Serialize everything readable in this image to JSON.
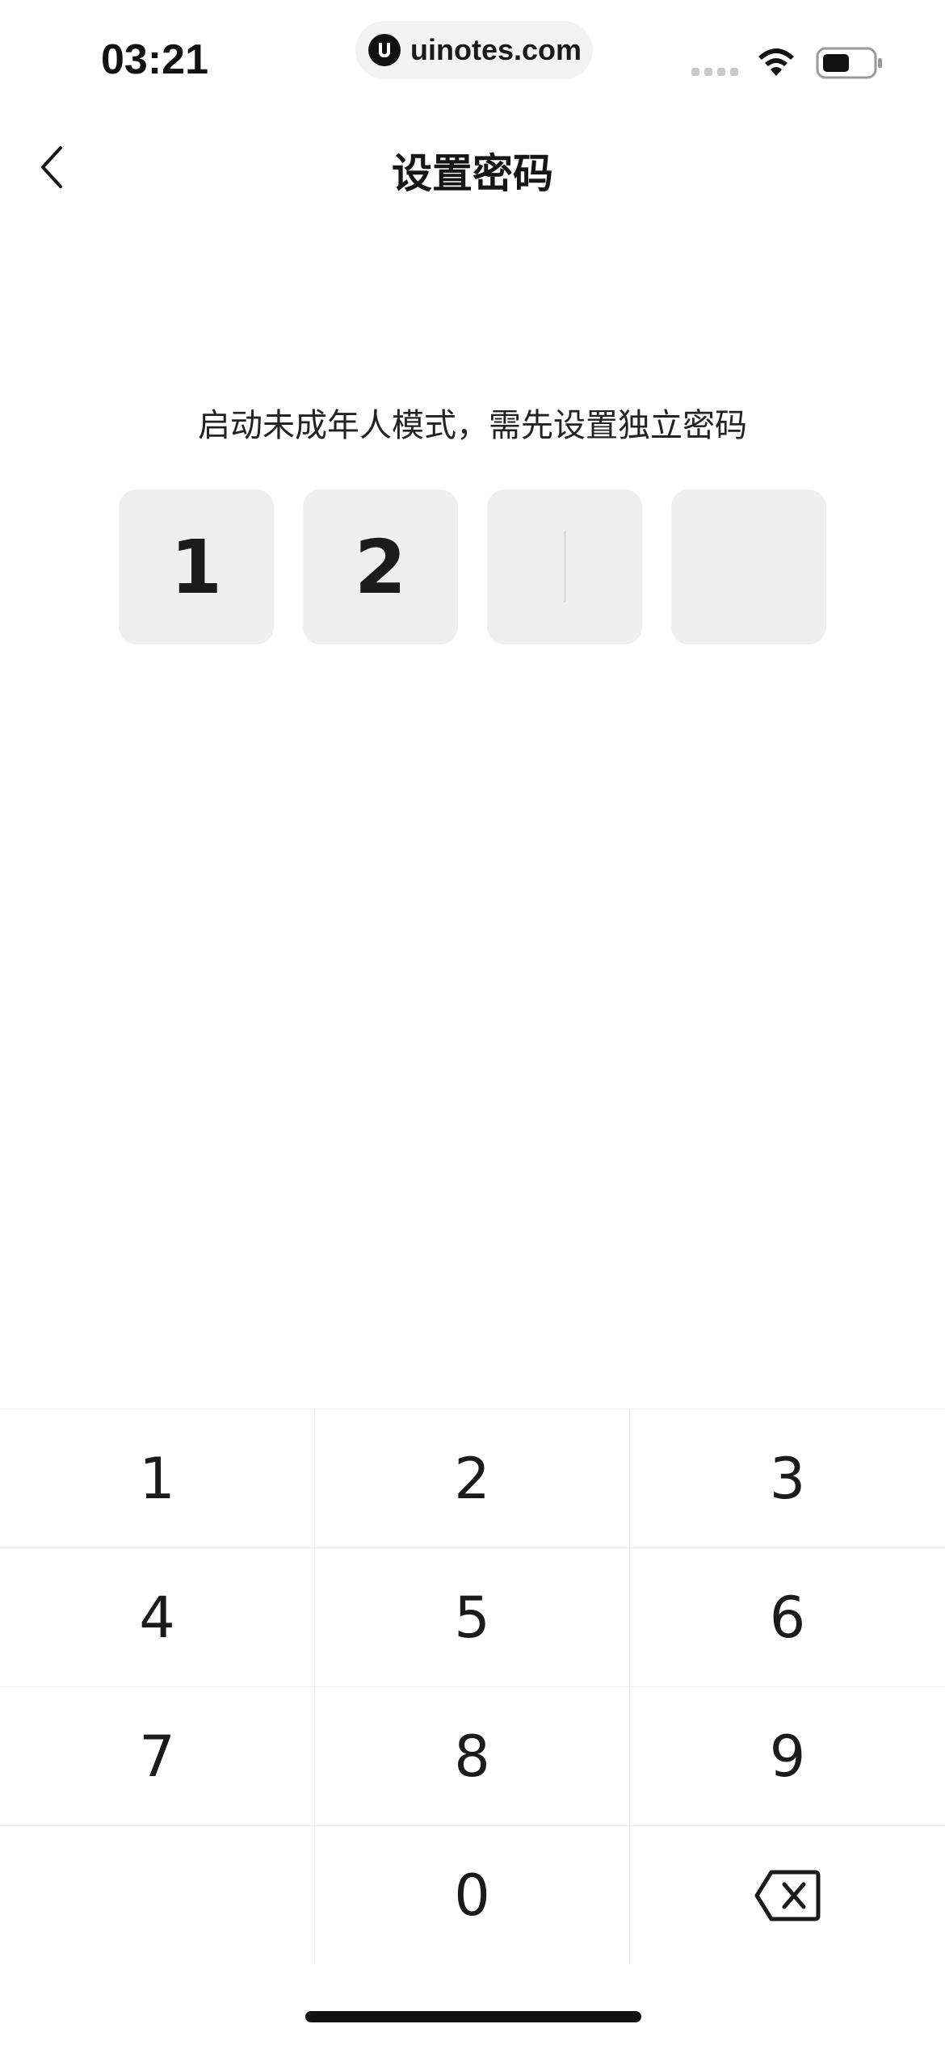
{
  "status_bar": {
    "time": "03:21",
    "url": "uinotes.com",
    "icons": [
      "uinotes-logo-icon",
      "signal-icon",
      "wifi-icon",
      "battery-icon"
    ]
  },
  "nav": {
    "back_icon": "chevron-left-icon",
    "title": "设置密码"
  },
  "prompt": "启动未成年人模式，需先设置独立密码",
  "pin": {
    "digits": [
      "1",
      "2",
      "",
      ""
    ],
    "filled_count": 2,
    "length": 4
  },
  "keypad": {
    "keys": [
      "1",
      "2",
      "3",
      "4",
      "5",
      "6",
      "7",
      "8",
      "9",
      "",
      "0"
    ],
    "delete_icon": "backspace-icon"
  },
  "colors": {
    "background": "#ffffff",
    "pin_box": "#efefef",
    "text": "#161616",
    "divider": "#ececec"
  }
}
